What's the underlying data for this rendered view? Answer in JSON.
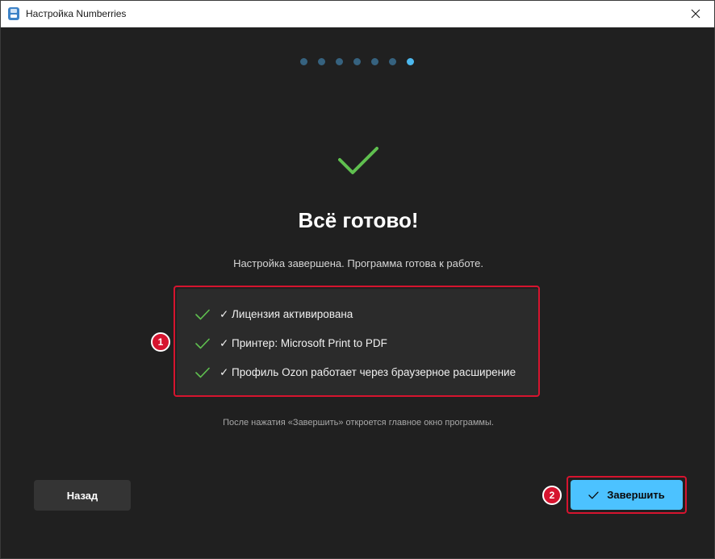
{
  "window": {
    "title": "Настройка Numberries"
  },
  "wizard": {
    "total_steps": 7,
    "current_step": 7
  },
  "main": {
    "heading": "Всё готово!",
    "subtitle": "Настройка завершена. Программа готова к работе.",
    "summary_items": [
      {
        "label": "✓ Лицензия активирована"
      },
      {
        "label": "✓ Принтер: Microsoft Print to PDF"
      },
      {
        "label": "✓ Профиль Ozon работает через браузерное расширение"
      }
    ],
    "note": "После нажатия «Завершить» откроется главное окно программы."
  },
  "footer": {
    "back_label": "Назад",
    "finish_label": "Завершить"
  },
  "annotations": {
    "badge1": "1",
    "badge2": "2"
  },
  "colors": {
    "accent": "#4cc2ff",
    "success": "#5fbf4f",
    "highlight": "#d6142f"
  },
  "icons": [
    "app-icon",
    "close-icon",
    "success-check-icon",
    "check-icon"
  ]
}
